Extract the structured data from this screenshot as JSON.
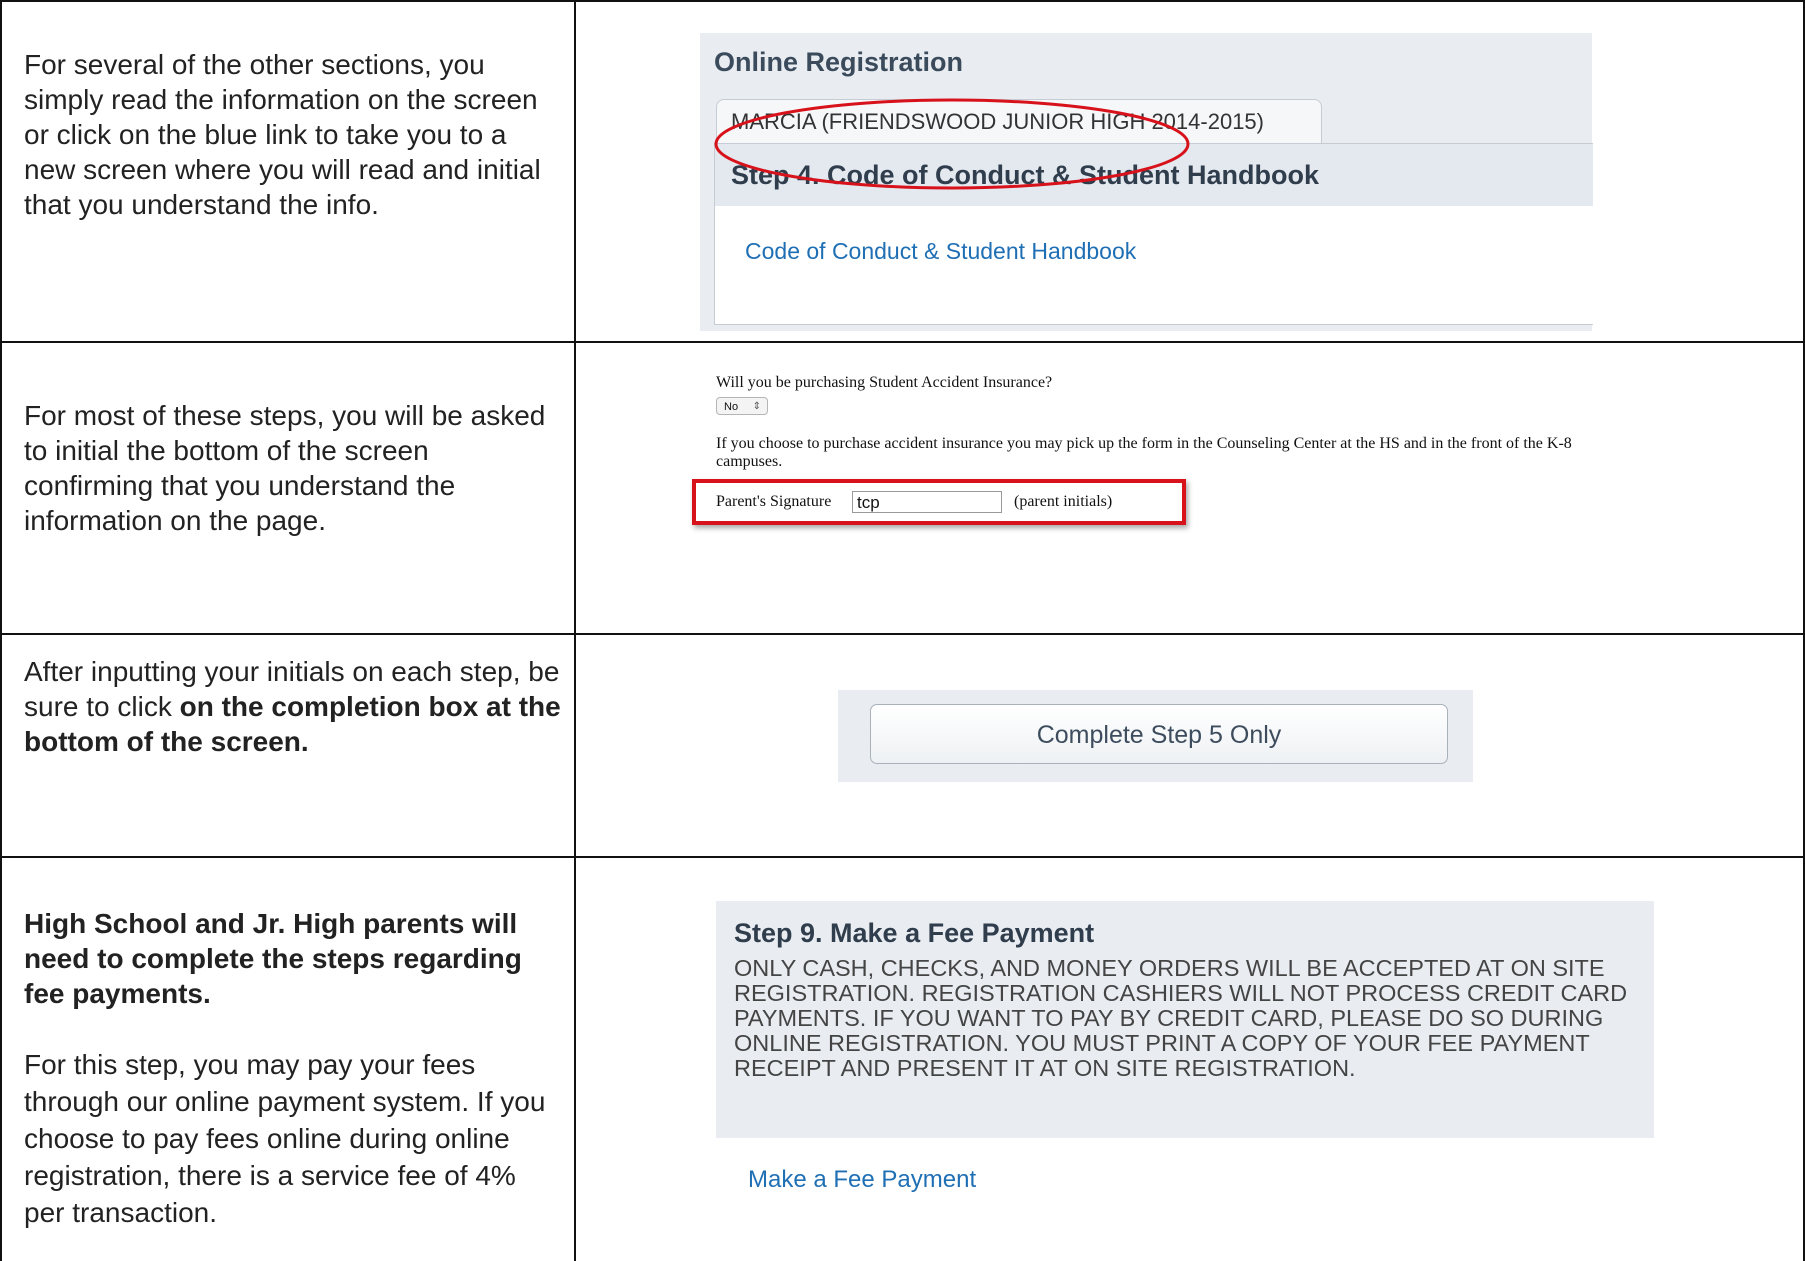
{
  "rows": [
    {
      "text": "For several of the other sections, you simply read the information on the screen or click on the blue link to take you to a new screen where you will read and initial that you understand the info.",
      "screenshot": {
        "title": "Online Registration",
        "student_tab": "MARCIA (FRIENDSWOOD JUNIOR HIGH 2014-2015)",
        "step_title": "Step 4. Code of Conduct & Student Handbook",
        "link": "Code of Conduct & Student Handbook"
      }
    },
    {
      "text": "For most of these steps, you will be asked to initial the bottom of the screen confirming that you understand the information on the page.",
      "screenshot": {
        "question": "Will you be purchasing Student Accident Insurance?",
        "select_value": "No",
        "info": "If you choose to purchase accident insurance you may pick up the form in the Counseling Center at the HS and in the front of the K-8 campuses.",
        "signature_label": "Parent's Signature",
        "signature_value": "tcp",
        "signature_hint": "(parent initials)"
      }
    },
    {
      "text_plain": "After inputting your initials on each step, be sure to click ",
      "text_bold": "on the completion box at the bottom of the screen.",
      "screenshot": {
        "button": "Complete Step 5 Only"
      }
    },
    {
      "text_bold": "High School and Jr. High parents will need to complete the steps regarding fee payments.",
      "text": "For this step, you may pay your fees through our online payment system. If you choose to pay fees online during online registration, there is a service fee of 4% per transaction.",
      "screenshot": {
        "step_title": "Step 9. Make a Fee Payment",
        "notice": "ONLY CASH, CHECKS, AND MONEY ORDERS WILL BE ACCEPTED AT ON SITE REGISTRATION. REGISTRATION CASHIERS WILL NOT PROCESS CREDIT CARD PAYMENTS. IF YOU WANT TO PAY BY CREDIT CARD, PLEASE DO SO DURING ONLINE REGISTRATION. YOU MUST PRINT A COPY OF YOUR FEE PAYMENT RECEIPT AND PRESENT IT AT ON SITE REGISTRATION.",
        "link": "Make a Fee Payment"
      }
    }
  ],
  "colors": {
    "link": "#1f6fb5",
    "highlight_red": "#d8121b",
    "panel_bg": "#e9edf2"
  }
}
